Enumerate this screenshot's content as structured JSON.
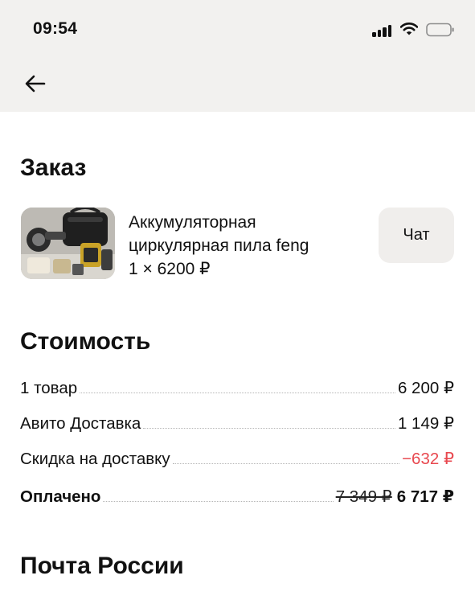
{
  "status_bar": {
    "time": "09:54"
  },
  "header": {
    "back_icon": "arrow-left-icon"
  },
  "order": {
    "title": "Заказ",
    "item": {
      "name_line1": "Аккумуляторная",
      "name_line2": "циркулярная пила feng",
      "quantity_price": "1 × 6200 ₽"
    },
    "chat_label": "Чат"
  },
  "cost": {
    "title": "Стоимость",
    "rows": [
      {
        "label": "1 товар",
        "value": "6 200 ₽"
      },
      {
        "label": "Авито Доставка",
        "value": "1 149 ₽"
      },
      {
        "label": "Скидка на доставку",
        "value": "−632 ₽"
      }
    ],
    "paid": {
      "label": "Оплачено",
      "old_value": "7 349 ₽",
      "value": "6 717 ₽"
    }
  },
  "delivery": {
    "title": "Почта России"
  },
  "colors": {
    "discount": "#e8484f",
    "topbar_bg": "#f2f1ef",
    "chat_bg": "#f0eeec"
  }
}
